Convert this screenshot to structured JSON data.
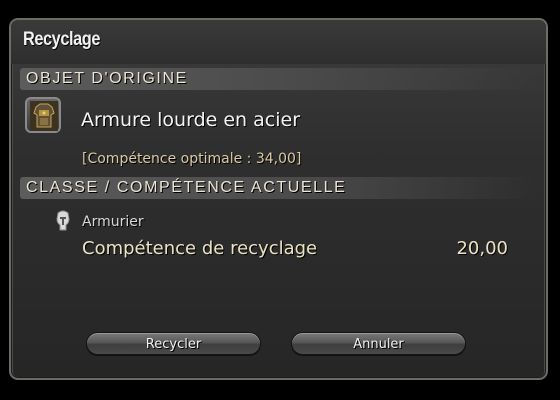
{
  "window": {
    "title": "Recyclage"
  },
  "origin_section": {
    "header": "OBJET D'ORIGINE",
    "item_name": "Armure lourde en acier",
    "item_icon": "heavy-armor-icon",
    "optimal_skill": "[Compétence optimale : 34,00]"
  },
  "class_section": {
    "header": "CLASSE / COMPÉTENCE ACTUELLE",
    "job_icon": "armorer-icon",
    "job_name": "Armurier",
    "skill_label": "Compétence de recyclage",
    "skill_value": "20,00"
  },
  "buttons": {
    "recycle_label": "Recycler",
    "cancel_label": "Annuler"
  },
  "colors": {
    "text_primary": "#f4f4f4",
    "text_accent": "#ece3c5",
    "optimal_text": "#d9cba2"
  }
}
